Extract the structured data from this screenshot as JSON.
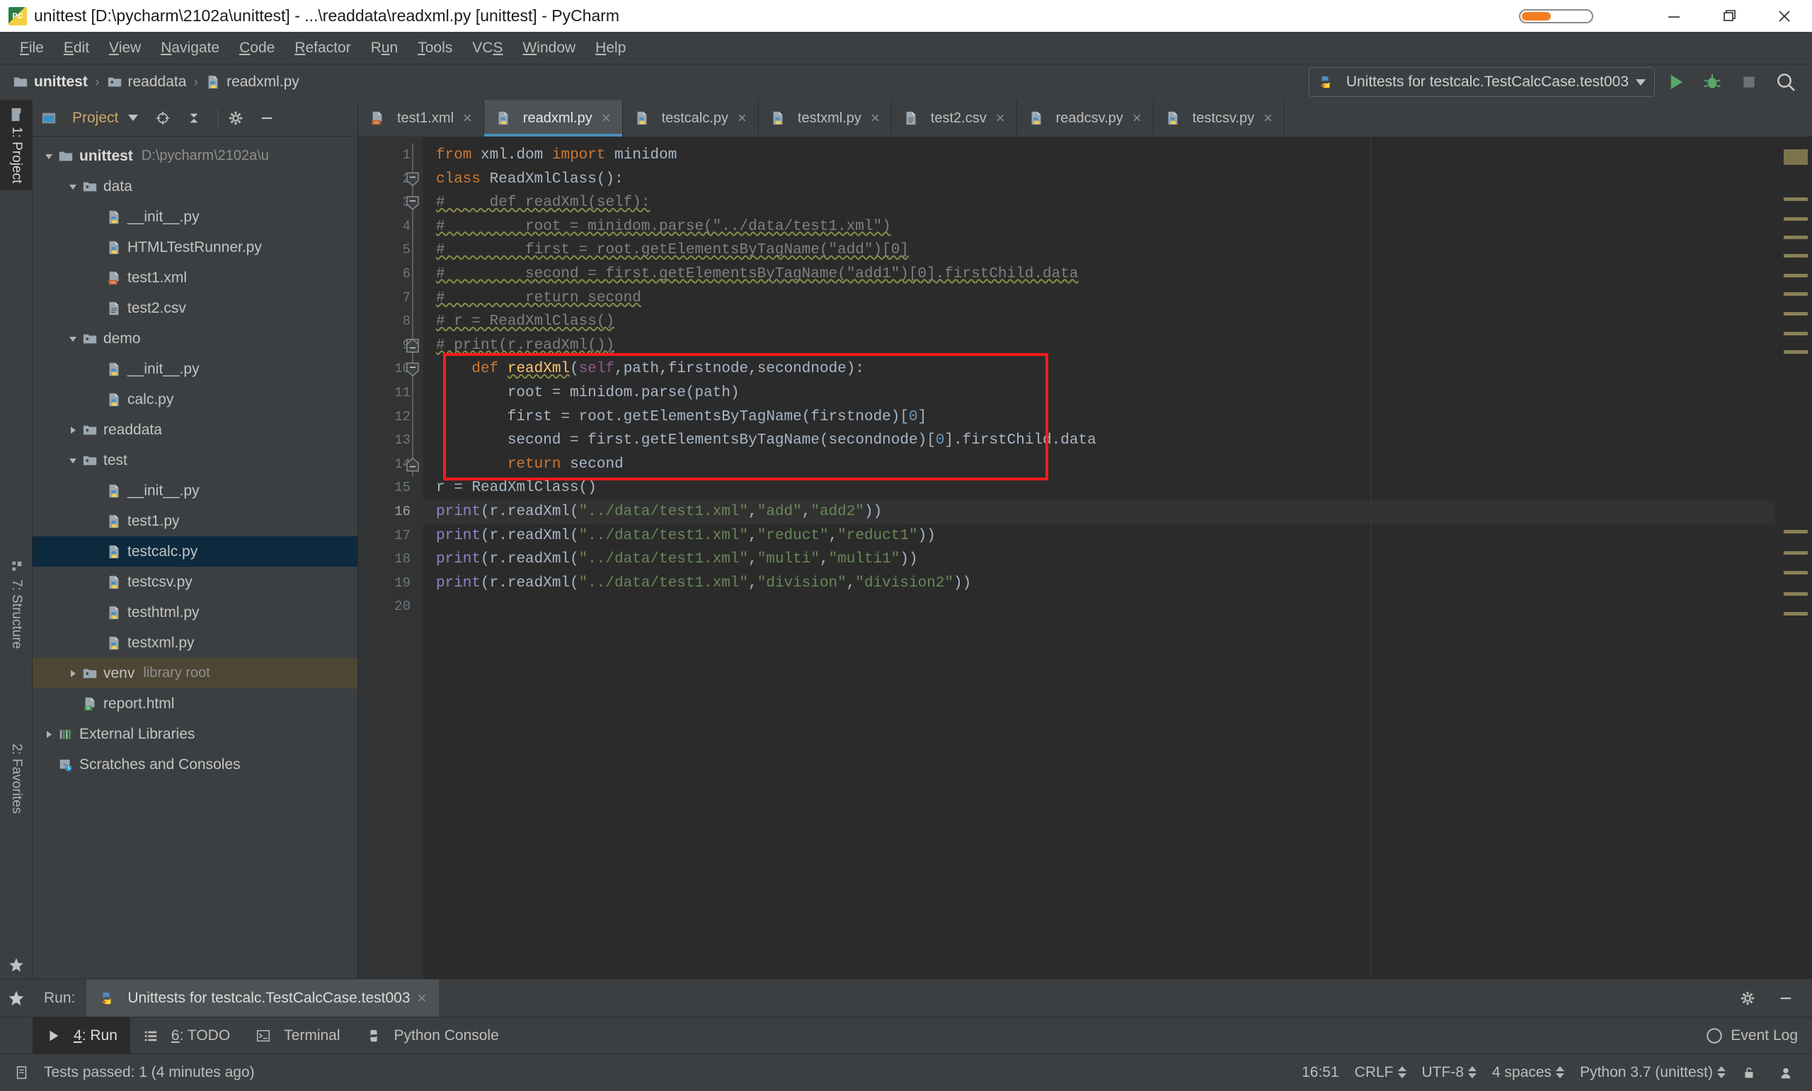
{
  "window": {
    "title": "unittest [D:\\pycharm\\2102a\\unittest] - ...\\readdata\\readxml.py [unittest] - PyCharm",
    "app_icon": "pycharm-icon",
    "minimize": "minimize-icon",
    "maximize": "maximize-icon",
    "close": "close-icon"
  },
  "menubar": {
    "items": [
      {
        "label": "File",
        "mnemonic": "F"
      },
      {
        "label": "Edit",
        "mnemonic": "E"
      },
      {
        "label": "View",
        "mnemonic": "V"
      },
      {
        "label": "Navigate",
        "mnemonic": "N"
      },
      {
        "label": "Code",
        "mnemonic": "C"
      },
      {
        "label": "Refactor",
        "mnemonic": "R"
      },
      {
        "label": "Run",
        "mnemonic": "u"
      },
      {
        "label": "Tools",
        "mnemonic": "T"
      },
      {
        "label": "VCS",
        "mnemonic": "S"
      },
      {
        "label": "Window",
        "mnemonic": "W"
      },
      {
        "label": "Help",
        "mnemonic": "H"
      }
    ]
  },
  "navbar": {
    "breadcrumbs": [
      {
        "label": "unittest",
        "icon": "folder-icon"
      },
      {
        "label": "readdata",
        "icon": "folder-source-icon"
      },
      {
        "label": "readxml.py",
        "icon": "python-file-icon"
      }
    ],
    "run_config": "Unittests for testcalc.TestCalcCase.test003",
    "run_config_icon": "python-test-icon",
    "dropdown_icon": "chevron-down-icon",
    "run_icon": "run-icon",
    "debug_icon": "debug-icon",
    "stop_icon": "stop-icon",
    "search_icon": "search-icon"
  },
  "left_strip": {
    "project": "1: Project",
    "structure": "7: Structure",
    "favorites": "2: Favorites"
  },
  "project_panel": {
    "title": "Project",
    "title_dropdown_icon": "chevron-down-icon",
    "locate_icon": "target-icon",
    "collapse_icon": "collapse-all-icon",
    "settings_icon": "gear-icon",
    "hide_icon": "minimize-icon",
    "tree": [
      {
        "label": "unittest",
        "meta": "D:\\pycharm\\2102a\\u",
        "depth": 0,
        "icon": "folder-icon",
        "twisty": "down",
        "bold": true,
        "state": "normal"
      },
      {
        "label": "data",
        "meta": "",
        "depth": 1,
        "icon": "folder-source-icon",
        "twisty": "down",
        "bold": false,
        "state": "normal"
      },
      {
        "label": "__init__.py",
        "meta": "",
        "depth": 2,
        "icon": "python-file-icon",
        "twisty": "none",
        "bold": false,
        "state": "normal"
      },
      {
        "label": "HTMLTestRunner.py",
        "meta": "",
        "depth": 2,
        "icon": "python-file-icon",
        "twisty": "none",
        "bold": false,
        "state": "normal"
      },
      {
        "label": "test1.xml",
        "meta": "",
        "depth": 2,
        "icon": "xml-file-icon",
        "twisty": "none",
        "bold": false,
        "state": "normal"
      },
      {
        "label": "test2.csv",
        "meta": "",
        "depth": 2,
        "icon": "csv-file-icon",
        "twisty": "none",
        "bold": false,
        "state": "normal"
      },
      {
        "label": "demo",
        "meta": "",
        "depth": 1,
        "icon": "folder-source-icon",
        "twisty": "down",
        "bold": false,
        "state": "normal"
      },
      {
        "label": "__init__.py",
        "meta": "",
        "depth": 2,
        "icon": "python-file-icon",
        "twisty": "none",
        "bold": false,
        "state": "normal"
      },
      {
        "label": "calc.py",
        "meta": "",
        "depth": 2,
        "icon": "python-file-icon",
        "twisty": "none",
        "bold": false,
        "state": "normal"
      },
      {
        "label": "readdata",
        "meta": "",
        "depth": 1,
        "icon": "folder-source-icon",
        "twisty": "right",
        "bold": false,
        "state": "normal"
      },
      {
        "label": "test",
        "meta": "",
        "depth": 1,
        "icon": "folder-source-icon",
        "twisty": "down",
        "bold": false,
        "state": "normal"
      },
      {
        "label": "__init__.py",
        "meta": "",
        "depth": 2,
        "icon": "python-file-icon",
        "twisty": "none",
        "bold": false,
        "state": "normal"
      },
      {
        "label": "test1.py",
        "meta": "",
        "depth": 2,
        "icon": "python-file-icon",
        "twisty": "none",
        "bold": false,
        "state": "normal"
      },
      {
        "label": "testcalc.py",
        "meta": "",
        "depth": 2,
        "icon": "python-file-icon",
        "twisty": "none",
        "bold": false,
        "state": "selected"
      },
      {
        "label": "testcsv.py",
        "meta": "",
        "depth": 2,
        "icon": "python-file-icon",
        "twisty": "none",
        "bold": false,
        "state": "normal"
      },
      {
        "label": "testhtml.py",
        "meta": "",
        "depth": 2,
        "icon": "python-file-icon",
        "twisty": "none",
        "bold": false,
        "state": "normal"
      },
      {
        "label": "testxml.py",
        "meta": "",
        "depth": 2,
        "icon": "python-file-icon",
        "twisty": "none",
        "bold": false,
        "state": "normal"
      },
      {
        "label": "venv",
        "meta": "library root",
        "depth": 1,
        "icon": "folder-source-icon",
        "twisty": "right",
        "bold": false,
        "state": "highlight"
      },
      {
        "label": "report.html",
        "meta": "",
        "depth": 1,
        "icon": "html-file-icon",
        "twisty": "none",
        "bold": false,
        "state": "normal"
      },
      {
        "label": "External Libraries",
        "meta": "",
        "depth": 0,
        "icon": "libraries-icon",
        "twisty": "right",
        "bold": false,
        "state": "normal"
      },
      {
        "label": "Scratches and Consoles",
        "meta": "",
        "depth": 0,
        "icon": "scratches-icon",
        "twisty": "none",
        "bold": false,
        "state": "normal"
      }
    ]
  },
  "editor": {
    "tabs": [
      {
        "label": "test1.xml",
        "icon": "xml-file-icon",
        "active": false
      },
      {
        "label": "readxml.py",
        "icon": "python-file-icon",
        "active": true
      },
      {
        "label": "testcalc.py",
        "icon": "python-file-icon",
        "active": false
      },
      {
        "label": "testxml.py",
        "icon": "python-file-icon",
        "active": false
      },
      {
        "label": "test2.csv",
        "icon": "csv-file-icon",
        "active": false
      },
      {
        "label": "readcsv.py",
        "icon": "python-file-icon",
        "active": false
      },
      {
        "label": "testcsv.py",
        "icon": "python-file-icon",
        "active": false
      }
    ],
    "close_glyph": "×",
    "current_line": 16,
    "line_numbers": [
      1,
      2,
      3,
      4,
      5,
      6,
      7,
      8,
      9,
      10,
      11,
      12,
      13,
      14,
      15,
      16,
      17,
      18,
      19,
      20
    ],
    "lines": [
      {
        "n": 1,
        "text": "from xml.dom import minidom"
      },
      {
        "n": 2,
        "text": "class ReadXmlClass():"
      },
      {
        "n": 3,
        "text": "#     def readXml(self):"
      },
      {
        "n": 4,
        "text": "#         root = minidom.parse(\"../data/test1.xml\")"
      },
      {
        "n": 5,
        "text": "#         first = root.getElementsByTagName(\"add\")[0]"
      },
      {
        "n": 6,
        "text": "#         second = first.getElementsByTagName(\"add1\")[0].firstChild.data"
      },
      {
        "n": 7,
        "text": "#         return second"
      },
      {
        "n": 8,
        "text": "# r = ReadXmlClass()"
      },
      {
        "n": 9,
        "text": "# print(r.readXml())"
      },
      {
        "n": 10,
        "text": "    def readXml(self,path,firstnode,secondnode):"
      },
      {
        "n": 11,
        "text": "        root = minidom.parse(path)"
      },
      {
        "n": 12,
        "text": "        first = root.getElementsByTagName(firstnode)[0]"
      },
      {
        "n": 13,
        "text": "        second = first.getElementsByTagName(secondnode)[0].firstChild.data"
      },
      {
        "n": 14,
        "text": "        return second"
      },
      {
        "n": 15,
        "text": "r = ReadXmlClass()"
      },
      {
        "n": 16,
        "text": "print(r.readXml(\"../data/test1.xml\",\"add\",\"add2\"))"
      },
      {
        "n": 17,
        "text": "print(r.readXml(\"../data/test1.xml\",\"reduct\",\"reduct1\"))"
      },
      {
        "n": 18,
        "text": "print(r.readXml(\"../data/test1.xml\",\"multi\",\"multi1\"))"
      },
      {
        "n": 19,
        "text": "print(r.readXml(\"../data/test1.xml\",\"division\",\"division2\"))"
      },
      {
        "n": 20,
        "text": ""
      }
    ],
    "highlight_box": {
      "from_line": 10,
      "to_line": 14,
      "color": "#ff1a1a"
    }
  },
  "run_window": {
    "label": "Run:",
    "tab_title": "Unittests for testcalc.TestCalcCase.test003",
    "tab_icon": "python-test-icon",
    "close_glyph": "×",
    "settings_icon": "gear-icon",
    "hide_icon": "minimize-icon",
    "favorites_icon": "star-icon"
  },
  "bottom_bar": {
    "tabs": [
      {
        "label": "4: Run",
        "mnemonic": "4",
        "icon": "run-icon",
        "active": true
      },
      {
        "label": "6: TODO",
        "mnemonic": "6",
        "icon": "todo-icon",
        "active": false
      },
      {
        "label": "Terminal",
        "mnemonic": "",
        "icon": "terminal-icon",
        "active": false
      },
      {
        "label": "Python Console",
        "mnemonic": "",
        "icon": "python-console-icon",
        "active": false
      }
    ],
    "event_log": "Event Log",
    "event_log_icon": "event-log-icon"
  },
  "status_bar": {
    "message": "Tests passed: 1 (4 minutes ago)",
    "message_icon": "test-status-icon",
    "time": "16:51",
    "line_separator": "CRLF",
    "encoding": "UTF-8",
    "indent": "4 spaces",
    "interpreter": "Python 3.7 (unittest)",
    "lock_icon": "unlock-icon",
    "inspector_icon": "inspector-icon"
  },
  "colors": {
    "accent": "#4a90b8",
    "selection": "#0d293e",
    "highlight_row": "#4d4634",
    "warning": "#8a8058",
    "error_box": "#ff1a1a",
    "panel_bg": "#3c3f41",
    "editor_bg": "#2b2b2b",
    "keyword": "#cc7832",
    "string": "#6a8759",
    "function": "#ffc66d",
    "number": "#6897bb",
    "comment": "#808080",
    "self_param": "#94558d",
    "builtin": "#8888c6"
  }
}
